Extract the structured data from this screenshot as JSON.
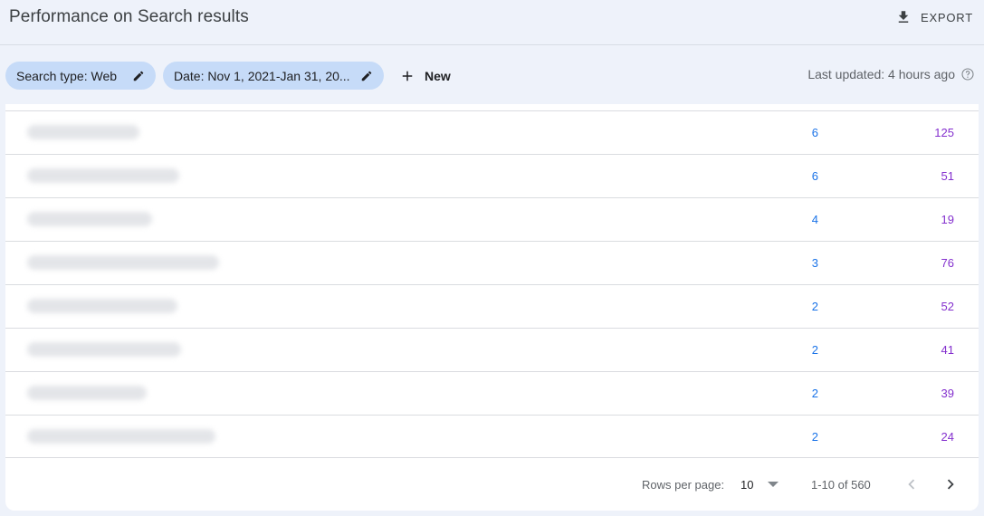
{
  "header": {
    "title": "Performance on Search results",
    "export_label": "EXPORT"
  },
  "filters": {
    "search_type": "Search type: Web",
    "date": "Date: Nov 1, 2021-Jan 31, 20...",
    "new_label": "New",
    "last_updated": "Last updated: 4 hours ago"
  },
  "table": {
    "rows": [
      {
        "clicks": "6",
        "impressions": "125"
      },
      {
        "clicks": "6",
        "impressions": "51"
      },
      {
        "clicks": "4",
        "impressions": "19"
      },
      {
        "clicks": "3",
        "impressions": "76"
      },
      {
        "clicks": "2",
        "impressions": "52"
      },
      {
        "clicks": "2",
        "impressions": "41"
      },
      {
        "clicks": "2",
        "impressions": "39"
      },
      {
        "clicks": "2",
        "impressions": "24"
      }
    ]
  },
  "pagination": {
    "rows_per_page_label": "Rows per page:",
    "rows_per_page_value": "10",
    "range": "1-10 of 560"
  },
  "colors": {
    "clicks": "#1a73e8",
    "impressions": "#8430ce",
    "chip": "#c6dbf8",
    "background": "#eef2fa"
  },
  "icons": {
    "export": "download-icon",
    "edit": "pencil-icon",
    "new": "plus-icon",
    "help": "help-circle-icon",
    "prev": "chevron-left-icon",
    "next": "chevron-right-icon",
    "dropdown": "caret-down-icon"
  }
}
